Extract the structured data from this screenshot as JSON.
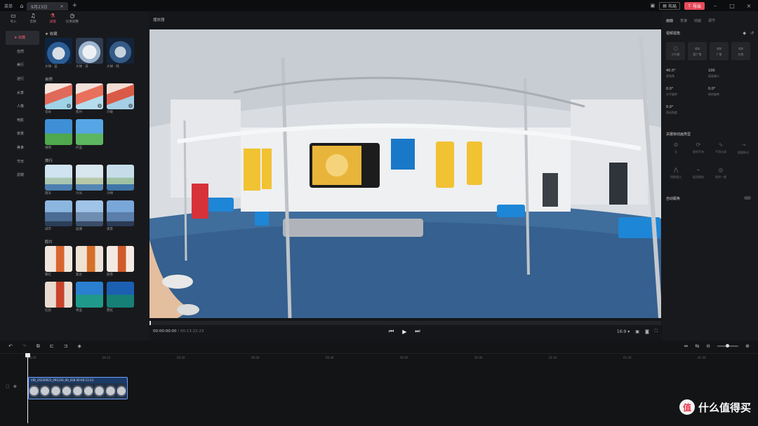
{
  "titlebar": {
    "menu": "菜单",
    "tab_title": "9月23日",
    "layout_label": "布局",
    "export_label": "导出"
  },
  "toptools": [
    {
      "icon": "folder-icon",
      "label": "导入"
    },
    {
      "icon": "music-icon",
      "label": "音频"
    },
    {
      "icon": "effects-icon",
      "label": "滤镜"
    },
    {
      "icon": "clock-icon",
      "label": "比例调整"
    }
  ],
  "categories": [
    "★ 收藏",
    "自然",
    "美行",
    "迷行",
    "水季",
    "人像",
    "电影",
    "夜景",
    "美食",
    "节日",
    "滤镜"
  ],
  "library": {
    "sections": [
      {
        "title": "★ 收藏",
        "items": [
          {
            "label": "大球 · 蓝"
          },
          {
            "label": "大球 · 白"
          },
          {
            "label": "大球 · 暗"
          }
        ]
      },
      {
        "title": "自然",
        "items": [
          {
            "label": "花朵"
          },
          {
            "label": "焦灼"
          },
          {
            "label": "冷暖"
          },
          {
            "label": "晴明"
          },
          {
            "label": "纤蓝"
          }
        ]
      },
      {
        "title": "旅行",
        "items": [
          {
            "label": "雨天"
          },
          {
            "label": "冷光"
          },
          {
            "label": "冷晴"
          },
          {
            "label": "城市"
          },
          {
            "label": "国潮"
          },
          {
            "label": "夜景"
          }
        ]
      },
      {
        "title": "胶片",
        "items": [
          {
            "label": "暖红"
          },
          {
            "label": "复古"
          },
          {
            "label": "胶卷"
          },
          {
            "label": "红韵"
          },
          {
            "label": "青蓝"
          },
          {
            "label": "霓虹"
          }
        ]
      }
    ]
  },
  "preview": {
    "title": "播放器",
    "timecode_current": "00:00:00:00",
    "timecode_total": "00:13:22:23",
    "aspect": "16:9 ▾"
  },
  "rightpanel": {
    "tabs": [
      "画面",
      "变速",
      "动画",
      "调节"
    ],
    "section_view": "视频视角",
    "lens": [
      {
        "icon": "ball-icon",
        "label": "小行星"
      },
      {
        "icon": "wide-icon",
        "label": "超广角"
      },
      {
        "icon": "normal-icon",
        "label": "广角"
      },
      {
        "icon": "tele-icon",
        "label": "长焦"
      }
    ],
    "params": [
      {
        "value": "40.0°",
        "label": "视场角"
      },
      {
        "value": "100",
        "label": "画面缩小"
      },
      {
        "value": "0.0°",
        "label": "水平旋转"
      },
      {
        "value": "0.0°",
        "label": "俯仰旋转"
      },
      {
        "value": "0.0°",
        "label": "滚动角度"
      }
    ],
    "section_keyframe": "关键帧动画类型",
    "aux": [
      {
        "label": "无"
      },
      {
        "label": "旋转开始"
      },
      {
        "label": "平滑过渡"
      },
      {
        "label": "缓慢移动"
      },
      {
        "label": "镜像跳过"
      },
      {
        "label": "缓速播放"
      },
      {
        "label": "旋转一圈"
      }
    ],
    "section_stabilize": "自动跟焦"
  },
  "timeline": {
    "ticks": [
      "00:00",
      "00:10",
      "00:20",
      "00:30",
      "00:40",
      "00:50",
      "01:00",
      "01:10",
      "01:20",
      "01:30",
      "01:40"
    ],
    "clip_name": "VID_20230923_091226_00_028 00:00:13:23"
  },
  "watermark": {
    "logo": "值",
    "text": "什么值得买"
  }
}
